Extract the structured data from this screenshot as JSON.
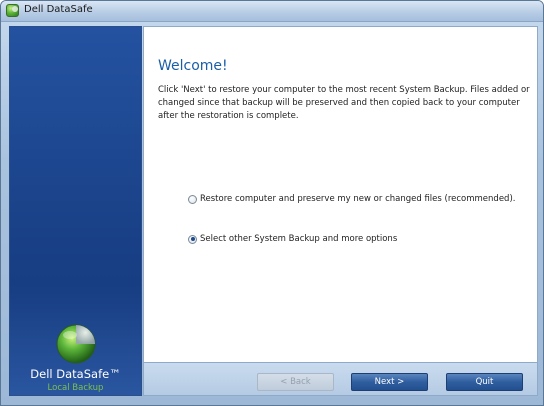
{
  "window": {
    "title": "Dell DataSafe"
  },
  "sidebar": {
    "brand_name": "Dell DataSafe™",
    "brand_sub": "Local Backup",
    "logo_icon": "datasafe-globe-icon"
  },
  "content": {
    "heading": "Welcome!",
    "intro": "Click 'Next' to restore your computer to the most recent System Backup.  Files added or changed since that backup will be preserved and then copied back to your computer after the restoration is complete.",
    "options": [
      {
        "label": "Restore computer and preserve my new or changed files (recommended).",
        "checked": false
      },
      {
        "label": "Select other System Backup and more options",
        "checked": true
      }
    ]
  },
  "footer": {
    "back_label": "< Back",
    "next_label": "Next >",
    "quit_label": "Quit",
    "back_enabled": false
  },
  "colors": {
    "accent": "#1b5ea8",
    "sidebar": "#1d4790",
    "brand_sub": "#7cc24a"
  }
}
